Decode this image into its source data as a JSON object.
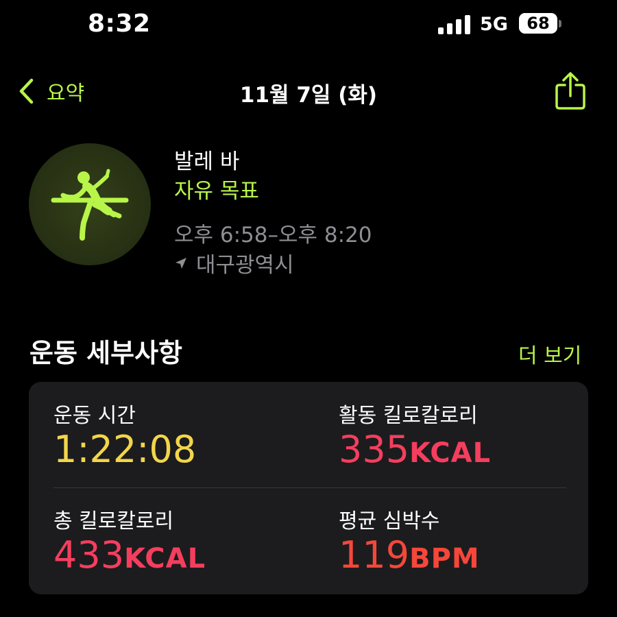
{
  "status_bar": {
    "time": "8:32",
    "network": "5G",
    "battery_level": "68"
  },
  "nav": {
    "back_label": "요약",
    "title": "11월 7일 (화)",
    "icons": {
      "back": "chevron-left-icon",
      "share": "share-icon"
    }
  },
  "workout": {
    "icon": "ballet-barre-icon",
    "name": "발레 바",
    "goal": "자유 목표",
    "time_range": "오후 6:58–오후 8:20",
    "location": "대구광역시"
  },
  "details": {
    "title": "운동 세부사항",
    "show_more": "더 보기",
    "stats": [
      {
        "label": "운동 시간",
        "value": "1:22:08",
        "unit": "",
        "color": "#f2d64b"
      },
      {
        "label": "활동 킬로칼로리",
        "value": "335",
        "unit": "KCAL",
        "color": "#f53e5e"
      },
      {
        "label": "총 킬로칼로리",
        "value": "433",
        "unit": "KCAL",
        "color": "#f53e5e"
      },
      {
        "label": "평균 심박수",
        "value": "119",
        "unit": "BPM",
        "color": "#f5473a"
      }
    ]
  },
  "colors": {
    "accent": "#b8f549",
    "secondary_text": "#8e8e93",
    "card_bg": "#1c1c1e"
  }
}
